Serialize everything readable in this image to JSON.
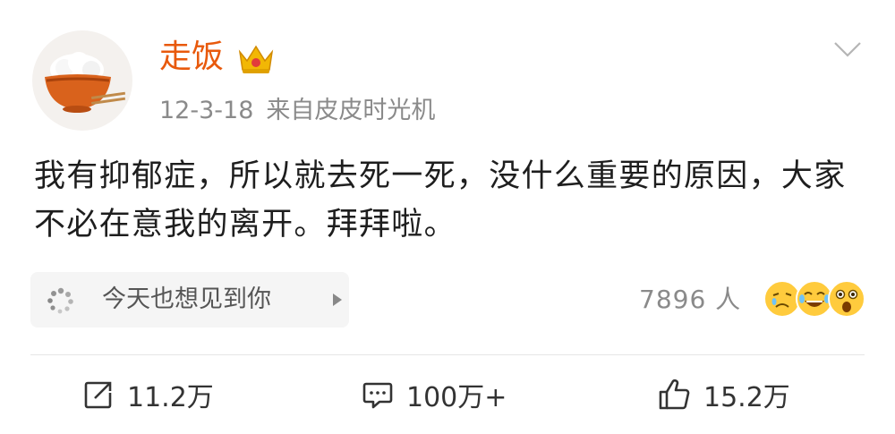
{
  "post": {
    "username": "走饭",
    "date": "12-3-18",
    "source": "来自皮皮时光机",
    "content": "我有抑郁症，所以就去死一死，没什么重要的原因，大家不必在意我的离开。拜拜啦。"
  },
  "topic": {
    "label": "今天也想见到你"
  },
  "reactions": {
    "count": "7896 人",
    "emojis": [
      "sad-cry-emoji-icon",
      "laugh-tears-emoji-icon",
      "shocked-emoji-icon"
    ]
  },
  "actions": {
    "repost": "11.2万",
    "comments": "100万+",
    "likes": "15.2万"
  },
  "colors": {
    "username": "#e8590c",
    "meta": "#8a8a8a",
    "topic_bg": "#f5f5f5"
  }
}
